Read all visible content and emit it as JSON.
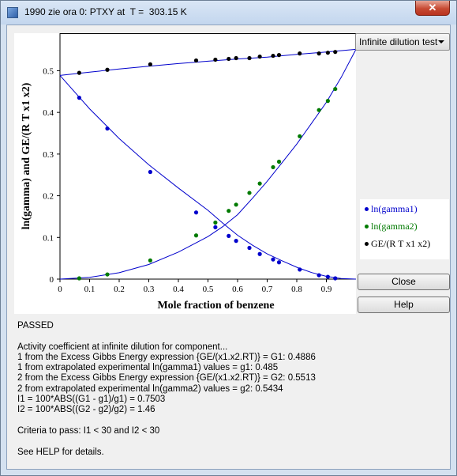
{
  "window": {
    "title": "1990 zie ora 0: PTXY at  T =  303.15 K",
    "close_symbol": "✕"
  },
  "controls": {
    "dropdown_value": "Infinite dilution test",
    "close_label": "Close",
    "help_label": "Help"
  },
  "legend": [
    {
      "label": "ln(gamma1)",
      "color": "#0000cc"
    },
    {
      "label": "ln(gamma2)",
      "color": "#007a00"
    },
    {
      "label": "GE/(R T x1 x2)",
      "color": "#000000"
    }
  ],
  "results": {
    "lines": [
      "PASSED",
      "",
      "Activity coefficient at infinite dilution for component...",
      "1 from the Excess Gibbs Energy expression {GE/(x1.x2.RT)} = G1: 0.4886",
      "1 from extrapolated experimental ln(gamma1) values = g1: 0.485",
      "2 from the Excess Gibbs Energy expression {GE/(x1.x2.RT)} = G2: 0.5513",
      "2 from extrapolated experimental ln(gamma2) values = g2: 0.5434",
      "I1 = 100*ABS((G1 - g1)/g1) = 0.7503",
      "I2 = 100*ABS((G2 - g2)/g2) = 1.46",
      "",
      "Criteria to pass: I1 < 30 and I2 < 30",
      "",
      "See HELP for details."
    ]
  },
  "chart_data": {
    "type": "scatter",
    "xlabel": "Mole fraction of benzene",
    "ylabel": "ln(gamma) and GE/(R T x1 x2)",
    "xlim": [
      0,
      1
    ],
    "ylim": [
      0,
      0.59
    ],
    "xticks": [
      "0",
      "0.1",
      "0.2",
      "0.3",
      "0.4",
      "0.5",
      "0.6",
      "0.7",
      "0.8",
      "0.9"
    ],
    "yticks": [
      "0",
      "0.1",
      "0.2",
      "0.3",
      "0.4",
      "0.5"
    ],
    "series": [
      {
        "name": "ln(gamma1)",
        "color": "#0000cc",
        "points": [
          [
            0.065,
            0.4351
          ],
          [
            0.16,
            0.3613
          ],
          [
            0.305,
            0.2571
          ],
          [
            0.46,
            0.1599
          ],
          [
            0.525,
            0.1245
          ],
          [
            0.57,
            0.1036
          ],
          [
            0.595,
            0.0918
          ],
          [
            0.64,
            0.0749
          ],
          [
            0.675,
            0.0602
          ],
          [
            0.72,
            0.0472
          ],
          [
            0.74,
            0.0403
          ],
          [
            0.81,
            0.023
          ],
          [
            0.875,
            0.0093
          ],
          [
            0.905,
            0.0056
          ],
          [
            0.93,
            0.0019
          ]
        ],
        "fit": [
          [
            0,
            0.4886
          ],
          [
            0.1,
            0.4087
          ],
          [
            0.2,
            0.3374
          ],
          [
            0.3,
            0.2744
          ],
          [
            0.4,
            0.2186
          ],
          [
            0.5,
            0.165
          ],
          [
            0.55,
            0.1341
          ],
          [
            0.6,
            0.1052
          ],
          [
            0.65,
            0.0813
          ],
          [
            0.7,
            0.0606
          ],
          [
            0.75,
            0.044
          ],
          [
            0.8,
            0.0285
          ],
          [
            0.85,
            0.0157
          ],
          [
            0.9,
            0.0067
          ],
          [
            0.95,
            0.0016
          ],
          [
            1,
            0
          ]
        ]
      },
      {
        "name": "ln(gamma2)",
        "color": "#007a00",
        "points": [
          [
            0.065,
            0.0019
          ],
          [
            0.16,
            0.0112
          ],
          [
            0.305,
            0.0448
          ],
          [
            0.46,
            0.1048
          ],
          [
            0.525,
            0.1357
          ],
          [
            0.57,
            0.1637
          ],
          [
            0.595,
            0.1787
          ],
          [
            0.64,
            0.2069
          ],
          [
            0.675,
            0.2293
          ],
          [
            0.72,
            0.2686
          ],
          [
            0.74,
            0.2817
          ],
          [
            0.81,
            0.3428
          ],
          [
            0.875,
            0.4056
          ],
          [
            0.905,
            0.4276
          ],
          [
            0.93,
            0.4561
          ]
        ],
        "fit": [
          [
            0,
            0
          ],
          [
            0.1,
            0.0044
          ],
          [
            0.2,
            0.0153
          ],
          [
            0.3,
            0.0351
          ],
          [
            0.4,
            0.0648
          ],
          [
            0.5,
            0.102
          ],
          [
            0.55,
            0.126
          ],
          [
            0.6,
            0.1546
          ],
          [
            0.65,
            0.1938
          ],
          [
            0.7,
            0.2347
          ],
          [
            0.75,
            0.2793
          ],
          [
            0.8,
            0.324
          ],
          [
            0.85,
            0.3741
          ],
          [
            0.9,
            0.4242
          ],
          [
            0.95,
            0.4842
          ],
          [
            1,
            0.5513
          ]
        ]
      },
      {
        "name": "GE/(R T x1 x2)",
        "color": "#000000",
        "points": [
          [
            0.065,
            0.4949
          ],
          [
            0.16,
            0.5023
          ],
          [
            0.305,
            0.5153
          ],
          [
            0.46,
            0.5246
          ],
          [
            0.525,
            0.5265
          ],
          [
            0.57,
            0.5284
          ],
          [
            0.595,
            0.5302
          ],
          [
            0.64,
            0.5302
          ],
          [
            0.675,
            0.5339
          ],
          [
            0.72,
            0.5358
          ],
          [
            0.74,
            0.5376
          ],
          [
            0.81,
            0.5414
          ],
          [
            0.875,
            0.5414
          ],
          [
            0.905,
            0.5432
          ],
          [
            0.93,
            0.5451
          ]
        ],
        "fit": [
          [
            0,
            0.4886
          ],
          [
            0.1,
            0.4967
          ],
          [
            0.2,
            0.5041
          ],
          [
            0.3,
            0.5109
          ],
          [
            0.4,
            0.5172
          ],
          [
            0.5,
            0.5229
          ],
          [
            0.6,
            0.5281
          ],
          [
            0.7,
            0.5328
          ],
          [
            0.8,
            0.5392
          ],
          [
            0.9,
            0.5449
          ],
          [
            1,
            0.5513
          ]
        ]
      }
    ]
  }
}
